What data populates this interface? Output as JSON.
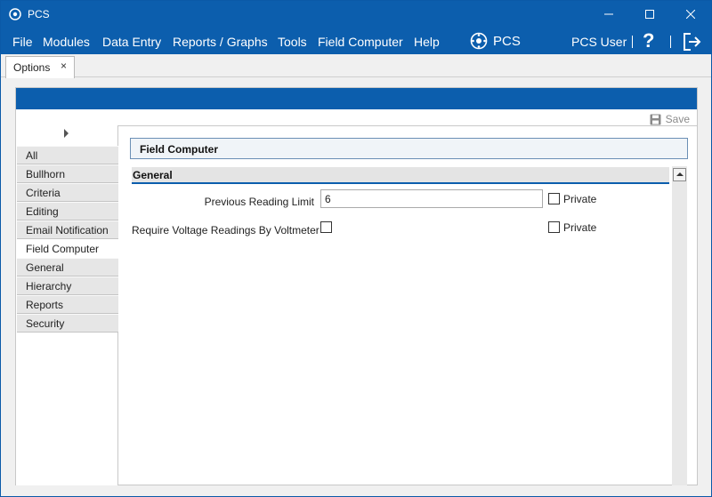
{
  "window": {
    "title": "PCS"
  },
  "menu": {
    "items": [
      "File",
      "Modules",
      "Data Entry",
      "Reports / Graphs",
      "Tools",
      "Field Computer",
      "Help"
    ],
    "brand": "PCS",
    "user": "PCS User",
    "help_symbol": "?"
  },
  "tab": {
    "label": "Options",
    "close_symbol": "×"
  },
  "toolbar": {
    "save_label": "Save"
  },
  "nav": {
    "items": [
      "All",
      "Bullhorn",
      "Criteria",
      "Editing",
      "Email Notification",
      "Field Computer",
      "General",
      "Hierarchy",
      "Reports",
      "Security"
    ],
    "active": "Field Computer"
  },
  "section": {
    "title": "Field Computer"
  },
  "group": {
    "title": "General"
  },
  "fields": {
    "previous_reading_limit": {
      "label": "Previous Reading Limit",
      "value": "6",
      "private_label": "Private",
      "private_checked": false
    },
    "require_voltage": {
      "label": "Require Voltage Readings By Voltmeter",
      "checked": false,
      "private_label": "Private",
      "private_checked": false
    }
  },
  "colors": {
    "accent": "#0c5ead"
  },
  "icons": {
    "app": "pcs-logo-icon",
    "save": "floppy-disk-icon",
    "logout": "logout-icon",
    "help": "question-mark-icon"
  }
}
